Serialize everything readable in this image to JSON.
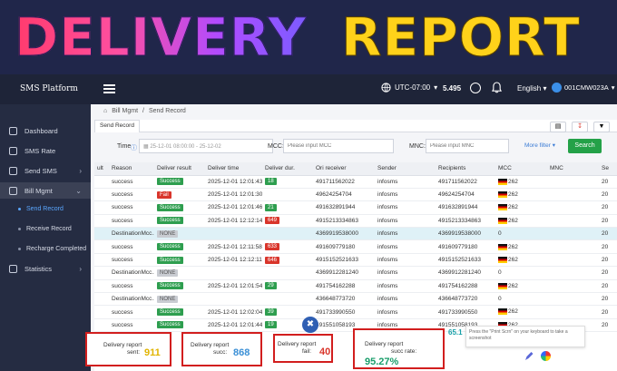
{
  "banner": {
    "word1": "DELIVERY",
    "word2": "REPORT"
  },
  "topbar": {
    "brand": "SMS Platform",
    "timezone": "UTC-07:00",
    "balance": "5.495",
    "language": "English",
    "user": "001CMW023A"
  },
  "sidebar": {
    "items": [
      {
        "label": "Dashboard"
      },
      {
        "label": "SMS Rate"
      },
      {
        "label": "Send SMS"
      },
      {
        "label": "Bill Mgmt"
      },
      {
        "label": "Statistics"
      }
    ],
    "subitems": [
      {
        "label": "Send Record"
      },
      {
        "label": "Receive Record"
      },
      {
        "label": "Recharge Completed"
      }
    ]
  },
  "breadcrumb": {
    "home": "⌂",
    "parent": "Bill Mgmt",
    "sep": "/",
    "current": "Send Record"
  },
  "tab": {
    "label": "Send Record"
  },
  "filters": {
    "time_label": "Time",
    "time_value": "25-12-01 08:00:00 - 25-12-02",
    "mcc_label": "MCC:",
    "mcc_placeholder": "Please input MCC",
    "mnc_label": "MNC:",
    "mnc_placeholder": "Please input MNC",
    "more_filter": "More filter ▾",
    "search_button": "Search"
  },
  "table": {
    "headers": [
      "ult",
      "Reason",
      "Deliver result",
      "Deliver time",
      "Deliver dur.",
      "Ori receiver",
      "Sender",
      "Recipients",
      "MCC",
      "MNC",
      "Se"
    ],
    "rows": [
      {
        "reason": "success",
        "result": "Success",
        "result_type": "success",
        "time": "2025-12-01 12:01:43",
        "dur": "18",
        "dur_type": "green",
        "ori": "491711562022",
        "sender": "infosms",
        "recip": "491711562022",
        "mcc": "262",
        "mnc": "",
        "se": "20"
      },
      {
        "reason": "success",
        "result": "Fail",
        "result_type": "fail",
        "time": "2025-12-01 12:01:30",
        "dur": "",
        "dur_type": "",
        "ori": "49624254704",
        "sender": "infosms",
        "recip": "49624254704",
        "mcc": "262",
        "mnc": "",
        "se": "20"
      },
      {
        "reason": "success",
        "result": "Success",
        "result_type": "success",
        "time": "2025-12-01 12:01:46",
        "dur": "21",
        "dur_type": "green",
        "ori": "491632891944",
        "sender": "infosms",
        "recip": "491632891944",
        "mcc": "262",
        "mnc": "",
        "se": "20"
      },
      {
        "reason": "success",
        "result": "Success",
        "result_type": "success",
        "time": "2025-12-01 12:12:14",
        "dur": "649",
        "dur_type": "red",
        "ori": "4915213334863",
        "sender": "infosms",
        "recip": "4915213334863",
        "mcc": "262",
        "mnc": "",
        "se": "20"
      },
      {
        "reason": "DestinationMcc...",
        "result": "NONE",
        "result_type": "none",
        "time": "",
        "dur": "",
        "dur_type": "",
        "ori": "4369919538000",
        "sender": "infosms",
        "recip": "4369919538000",
        "mcc": "0",
        "mnc": "",
        "se": "20",
        "highlight": true
      },
      {
        "reason": "success",
        "result": "Success",
        "result_type": "success",
        "time": "2025-12-01 12:11:58",
        "dur": "633",
        "dur_type": "red",
        "ori": "491609779180",
        "sender": "infosms",
        "recip": "491609779180",
        "mcc": "262",
        "mnc": "",
        "se": "20"
      },
      {
        "reason": "success",
        "result": "Success",
        "result_type": "success",
        "time": "2025-12-01 12:12:11",
        "dur": "646",
        "dur_type": "red",
        "ori": "4915152521633",
        "sender": "infosms",
        "recip": "4915152521633",
        "mcc": "262",
        "mnc": "",
        "se": "20"
      },
      {
        "reason": "DestinationMcc...",
        "result": "NONE",
        "result_type": "none",
        "time": "",
        "dur": "",
        "dur_type": "",
        "ori": "4369912281240",
        "sender": "infosms",
        "recip": "4369912281240",
        "mcc": "0",
        "mnc": "",
        "se": "20"
      },
      {
        "reason": "success",
        "result": "Success",
        "result_type": "success",
        "time": "2025-12-01 12:01:54",
        "dur": "29",
        "dur_type": "green",
        "ori": "491754162288",
        "sender": "infosms",
        "recip": "491754162288",
        "mcc": "262",
        "mnc": "",
        "se": "20"
      },
      {
        "reason": "DestinationMcc...",
        "result": "NONE",
        "result_type": "none",
        "time": "",
        "dur": "",
        "dur_type": "",
        "ori": "436648773720",
        "sender": "infosms",
        "recip": "436648773720",
        "mcc": "0",
        "mnc": "",
        "se": "20"
      },
      {
        "reason": "success",
        "result": "Success",
        "result_type": "success",
        "time": "2025-12-01 12:02:04",
        "dur": "39",
        "dur_type": "green",
        "ori": "491733990550",
        "sender": "infosms",
        "recip": "491733990550",
        "mcc": "262",
        "mnc": "",
        "se": "20"
      },
      {
        "reason": "success",
        "result": "Success",
        "result_type": "success",
        "time": "2025-12-01 12:01:44",
        "dur": "19",
        "dur_type": "green",
        "ori": "491551058193",
        "sender": "infosms",
        "recip": "491551058193",
        "mcc": "262",
        "mnc": "",
        "se": "20"
      }
    ]
  },
  "stats": [
    {
      "label1": "Delivery report",
      "label2": "sent:",
      "value": "911",
      "color": "#e1b400"
    },
    {
      "label1": "Delivery report",
      "label2": "succ:",
      "value": "868",
      "color": "#3a8fd6"
    },
    {
      "label1": "Delivery report",
      "label2": "fail:",
      "value": "40",
      "color": "#d9352b"
    },
    {
      "label1": "Delivery report",
      "label2": "succ rate:",
      "value": "95.27%",
      "color": "#1a9e6b"
    }
  ],
  "tooltip": {
    "text": "Press the \"Print Scrn\" on your keyboard to take a screenshot"
  },
  "partial_number": "65.1",
  "colors": {
    "accent": "#24a148",
    "danger": "#d9352b",
    "highlight": "#dff1f7"
  }
}
